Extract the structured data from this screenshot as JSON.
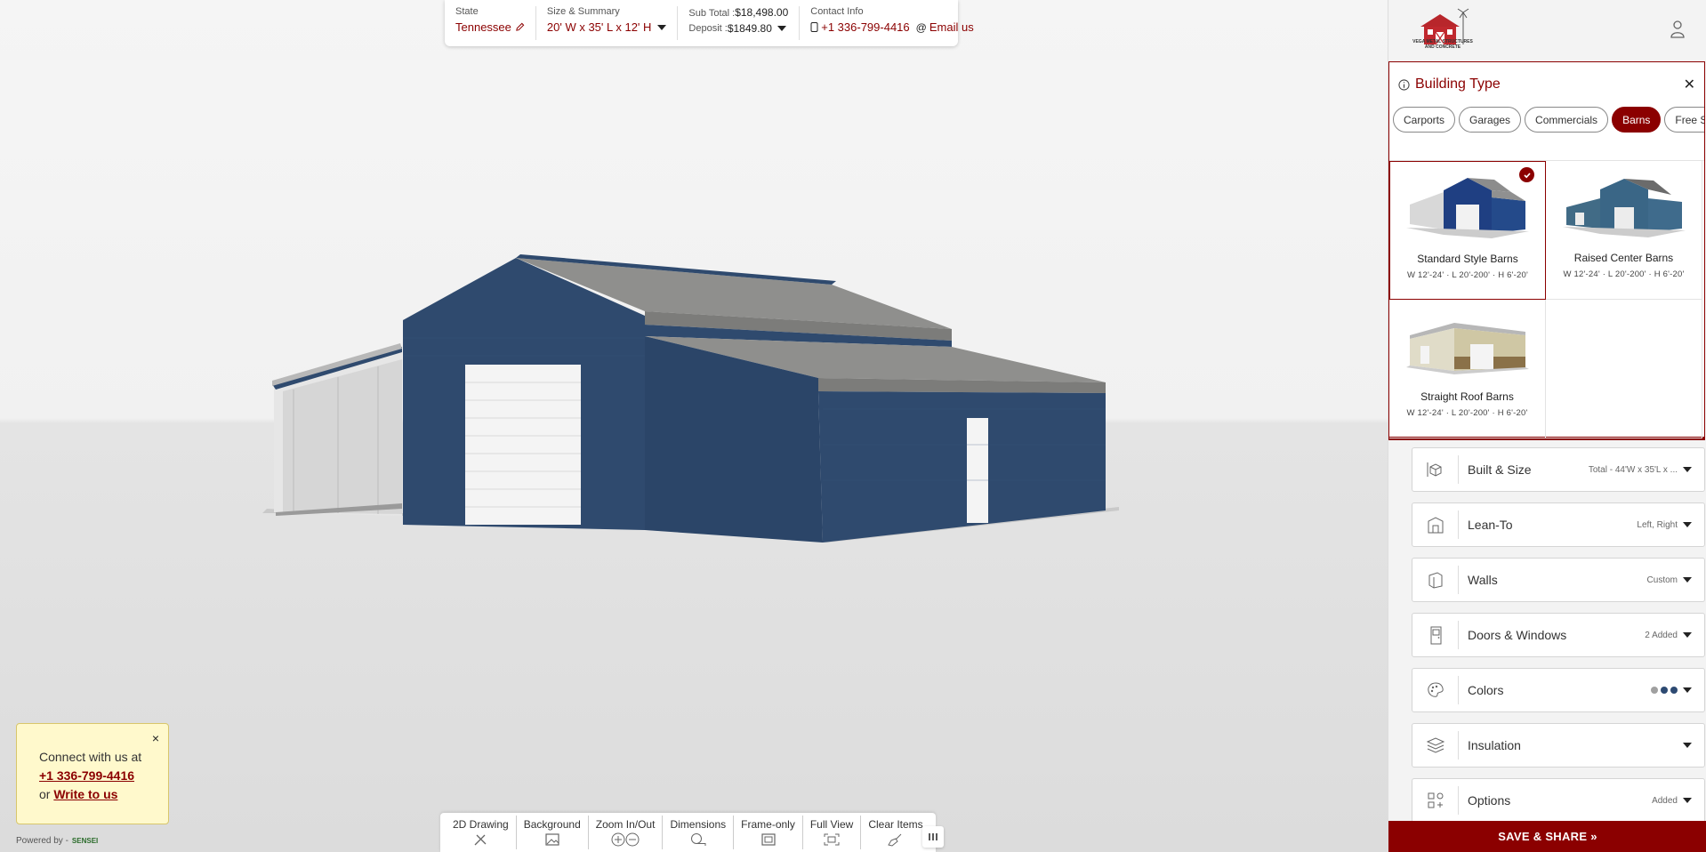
{
  "summary": {
    "state_label": "State",
    "state_value": "Tennessee",
    "size_label": "Size & Summary",
    "size_value": "20' W x 35' L x 12' H",
    "subtotal_label": "Sub Total :",
    "subtotal_value": "$18,498.00",
    "deposit_label": "Deposit :",
    "deposit_value": "$1849.80",
    "contact_label": "Contact Info",
    "phone": "+1 336-799-4416",
    "email_label": "Email us"
  },
  "toolbar": [
    {
      "label": "2D Drawing",
      "icon": "pencil-ruler-icon"
    },
    {
      "label": "Background",
      "icon": "image-icon"
    },
    {
      "label": "Zoom In/Out",
      "icon": "zoom-icon"
    },
    {
      "label": "Dimensions",
      "icon": "tape-measure-icon"
    },
    {
      "label": "Frame-only",
      "icon": "frame-icon"
    },
    {
      "label": "Full View",
      "icon": "fullscreen-icon"
    },
    {
      "label": "Clear Items",
      "icon": "broom-icon"
    }
  ],
  "connect": {
    "line1": "Connect with us at",
    "phone": "+1 336-799-4416",
    "or": "or",
    "write": "Write to us",
    "close": "×"
  },
  "powered": {
    "label": "Powered by -",
    "logo": "SENSEI"
  },
  "brand": {
    "name": "VEGA METAL STRUCTURES AND CONCRETE"
  },
  "building_type": {
    "title": "Building Type",
    "close": "✕",
    "tabs": [
      "Carports",
      "Garages",
      "Commercials",
      "Barns",
      "Free St"
    ],
    "active_tab": "Barns",
    "cards": [
      {
        "name": "Standard Style Barns",
        "dims": "W 12'-24'  ·  L 20'-200'  ·  H 6'-20'",
        "selected": true
      },
      {
        "name": "Raised Center Barns",
        "dims": "W 12'-24'  ·  L 20'-200'  ·  H 6'-20'",
        "selected": false
      },
      {
        "name": "Straight Roof Barns",
        "dims": "W 12'-24'  ·  L 20'-200'  ·  H 6'-20'",
        "selected": false
      }
    ]
  },
  "accordions": [
    {
      "label": "Built & Size",
      "summary": "Total - 44'W x 35'L x ...",
      "icon": "cube-size-icon"
    },
    {
      "label": "Lean-To",
      "summary": "Left, Right",
      "icon": "lean-to-icon"
    },
    {
      "label": "Walls",
      "summary": "Custom",
      "icon": "wall-icon"
    },
    {
      "label": "Doors & Windows",
      "summary": "2 Added",
      "icon": "door-icon"
    },
    {
      "label": "Colors",
      "summary": "",
      "icon": "palette-icon"
    },
    {
      "label": "Insulation",
      "summary": "",
      "icon": "layers-icon"
    },
    {
      "label": "Options",
      "summary": "Added",
      "icon": "grid-options-icon"
    }
  ],
  "color_dots": [
    "#a0a0a0",
    "#2d4a72",
    "#2d4a72"
  ],
  "save_label": "SAVE & SHARE »",
  "colors": {
    "accent": "#8b0000",
    "barn_blue": "#2f4a6e",
    "roof_gray": "#8e8e8c"
  }
}
